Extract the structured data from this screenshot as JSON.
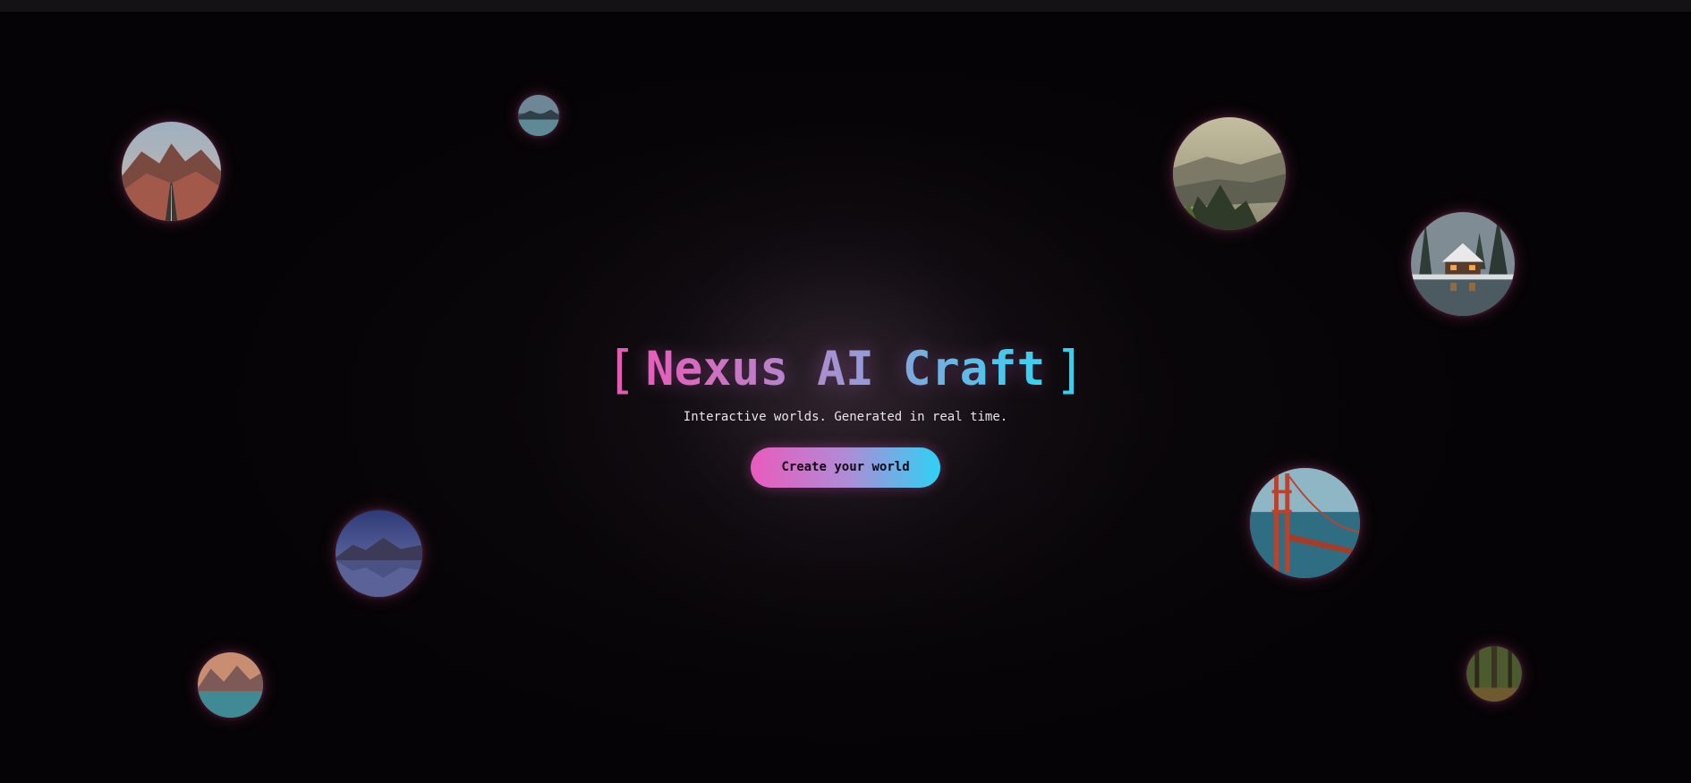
{
  "hero": {
    "bracket_left": "[",
    "title": "Nexus AI Craft",
    "bracket_right": "]",
    "tagline": "Interactive worlds. Generated in real time.",
    "cta_label": "Create your world"
  },
  "colors": {
    "background": "#060406",
    "gradient_start": "#e65eb9",
    "gradient_mid": "#a98fd0",
    "gradient_end": "#37d3f2",
    "bubble_glow": "#e65aa0"
  },
  "world_bubbles": [
    "desert-road-photo",
    "lake-photo",
    "mountain-valley-photo",
    "snowy-cabin-photo",
    "lake-mountain-dusk-photo",
    "golden-gate-bridge-photo",
    "alpine-lake-photo",
    "forest-photo"
  ]
}
